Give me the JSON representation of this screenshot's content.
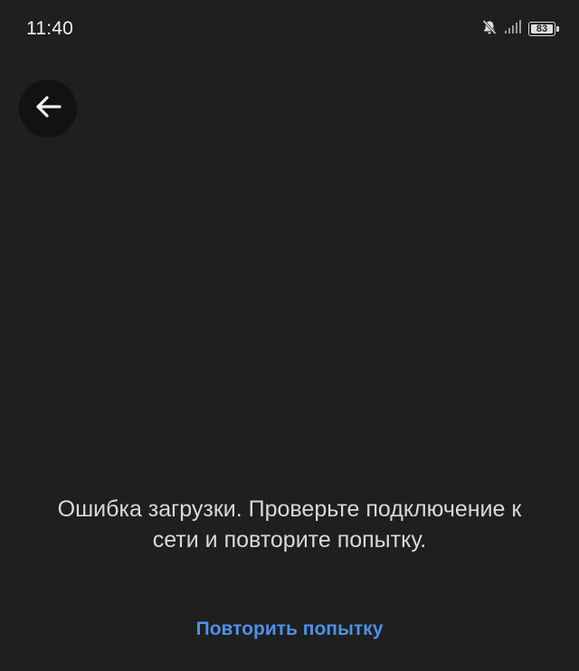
{
  "status_bar": {
    "time": "11:40",
    "icons": [
      "bell-off-icon",
      "signal-icon",
      "battery-icon"
    ],
    "battery_level": "83"
  },
  "toolbar": {
    "back_icon": "arrow-left-icon"
  },
  "error": {
    "message": "Ошибка загрузки. Проверьте подключение к сети и повторите попытку.",
    "retry_label": "Повторить попытку"
  },
  "colors": {
    "background": "#1f1f1f",
    "back_button_bg": "#121212",
    "text": "#d9d9d9",
    "accent": "#4f90e8"
  }
}
